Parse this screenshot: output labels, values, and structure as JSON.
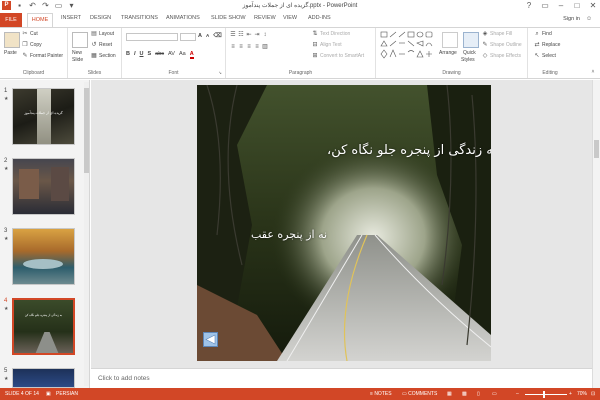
{
  "window": {
    "title": "گزیده ای از جملات پندآموز.pptx - PowerPoint",
    "controls": [
      "?",
      "▭",
      "–",
      "□",
      "✕"
    ]
  },
  "tabs": [
    "FILE",
    "HOME",
    "INSERT",
    "DESIGN",
    "TRANSITIONS",
    "ANIMATIONS",
    "SLIDE SHOW",
    "REVIEW",
    "VIEW",
    "ADD-INS"
  ],
  "user": {
    "signin": "Sign in"
  },
  "ribbon": {
    "clipboard": {
      "label": "Clipboard",
      "paste": "Paste",
      "cut": "Cut",
      "copy": "Copy",
      "format_painter": "Format Painter"
    },
    "slides": {
      "label": "Slides",
      "new_slide_1": "New",
      "new_slide_2": "Slide",
      "layout": "Layout",
      "reset": "Reset",
      "section": "Section"
    },
    "font": {
      "label": "Font",
      "bold": "B",
      "italic": "I",
      "underline": "U",
      "shadow": "S",
      "strike": "abc",
      "spacing": "AV",
      "case": "Aa",
      "color": "A",
      "grow": "A",
      "shrink": "A"
    },
    "paragraph": {
      "label": "Paragraph",
      "text_direction": "Text Direction",
      "align_text": "Align Text",
      "convert_smartart": "Convert to SmartArt"
    },
    "drawing": {
      "label": "Drawing",
      "arrange": "Arrange",
      "quick_styles_1": "Quick",
      "quick_styles_2": "Styles",
      "shape_fill": "Shape Fill",
      "shape_outline": "Shape Outline",
      "shape_effects": "Shape Effects"
    },
    "editing": {
      "label": "Editing",
      "find": "Find",
      "replace": "Replace",
      "select": "Select"
    }
  },
  "thumbnails": [
    {
      "num": "1",
      "caption": "گزیده ای از جملات پندآموز"
    },
    {
      "num": "2",
      "caption": ""
    },
    {
      "num": "3",
      "caption": ""
    },
    {
      "num": "4",
      "caption": "به زندگی از پنجره جلو نگاه کن"
    },
    {
      "num": "5",
      "caption": ""
    }
  ],
  "slide": {
    "title": "به زندگی از پنجره جلو نگاه کن،",
    "subtitle": "نه از پنجره عقب"
  },
  "notes": {
    "placeholder": "Click to add notes"
  },
  "status": {
    "slide_info": "SLIDE 4 OF 14",
    "language": "PERSIAN",
    "notes": "NOTES",
    "comments": "COMMENTS",
    "zoom": "70%"
  },
  "colors": {
    "accent": "#d24726",
    "ribbon_bg": "#ffffff",
    "workspace": "#e6e6e6"
  }
}
